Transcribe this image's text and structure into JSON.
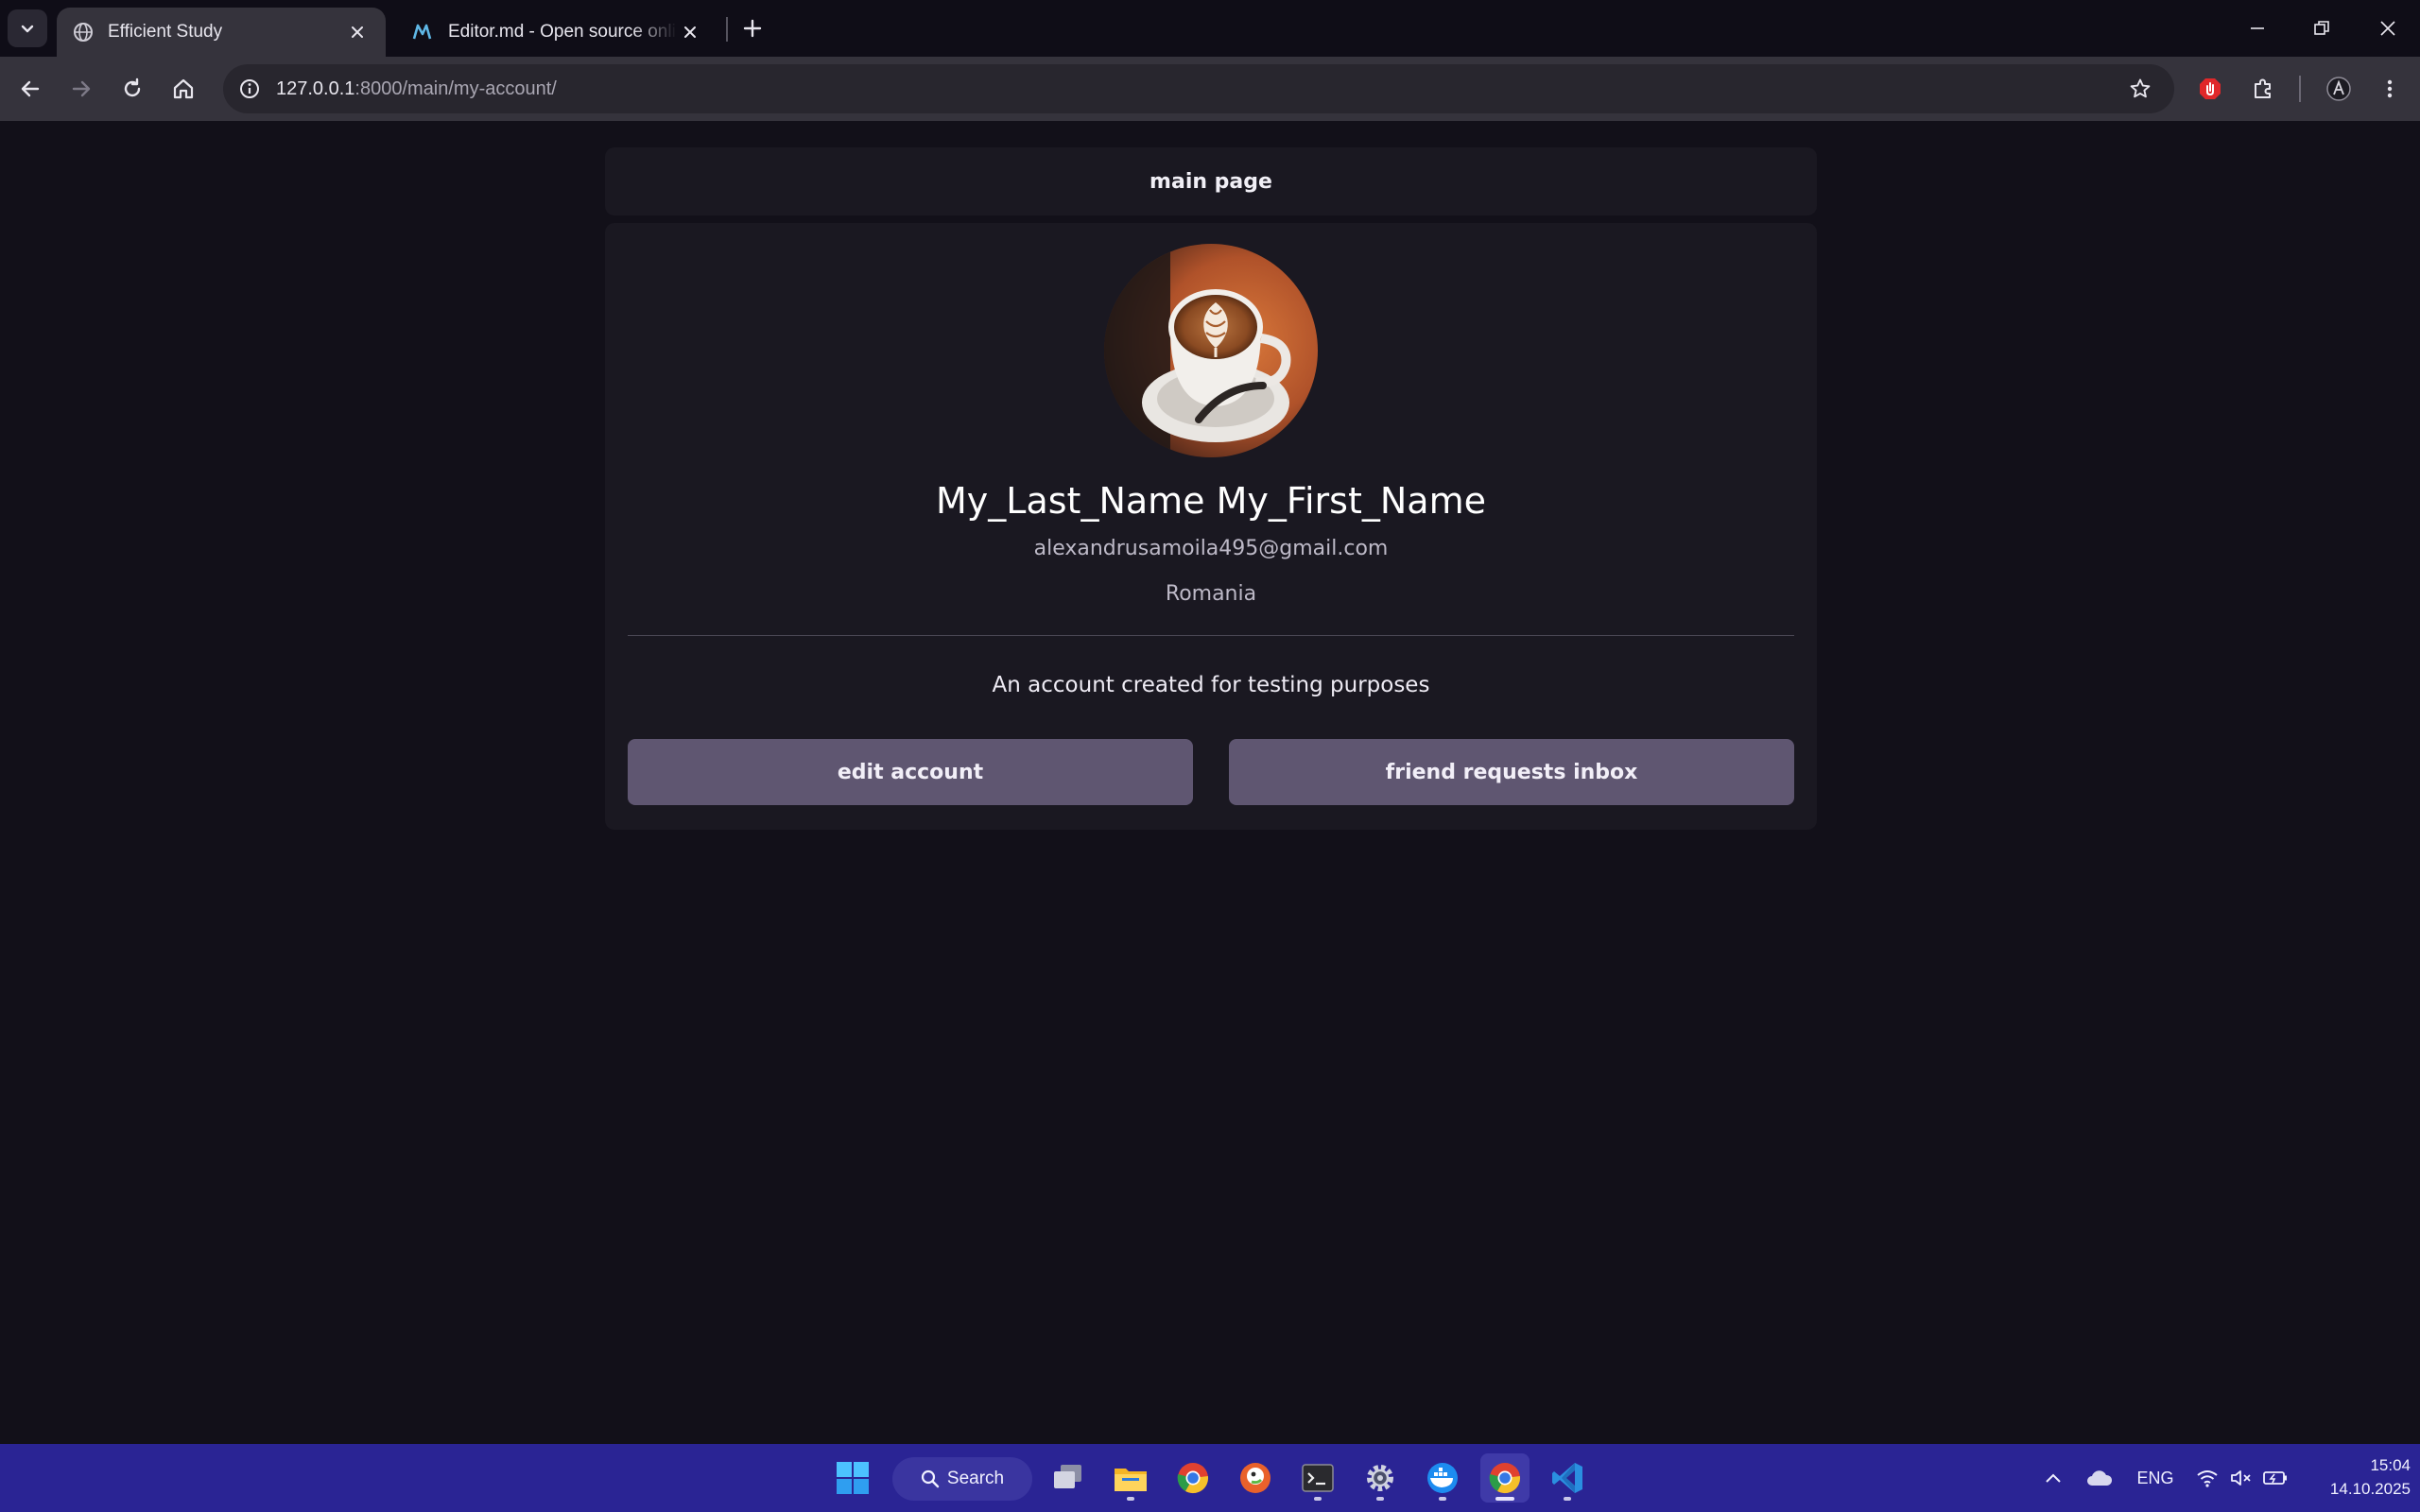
{
  "browser": {
    "tabs": [
      {
        "title": "Efficient Study",
        "active": true,
        "favicon": "globe-icon"
      },
      {
        "title": "Editor.md - Open source online",
        "active": false,
        "favicon": "editor-md-icon"
      }
    ],
    "url": {
      "host": "127.0.0.1",
      "rest": ":8000/main/my-account/"
    }
  },
  "page": {
    "nav_label": "main page",
    "profile": {
      "name": "My_Last_Name My_First_Name",
      "email": "alexandrusamoila495@gmail.com",
      "country": "Romania",
      "bio": "An account created for testing purposes",
      "avatar": "coffee-latte-art-avatar"
    },
    "buttons": {
      "edit": "edit account",
      "friends": "friend requests inbox"
    }
  },
  "taskbar": {
    "search_label": "Search",
    "language": "ENG",
    "time": "15:04",
    "date": "14.10.2025"
  },
  "colors": {
    "page_bg": "#121019",
    "card_bg": "#1a1821",
    "button_bg": "#5f5671",
    "taskbar_bg": "#2a2494"
  }
}
